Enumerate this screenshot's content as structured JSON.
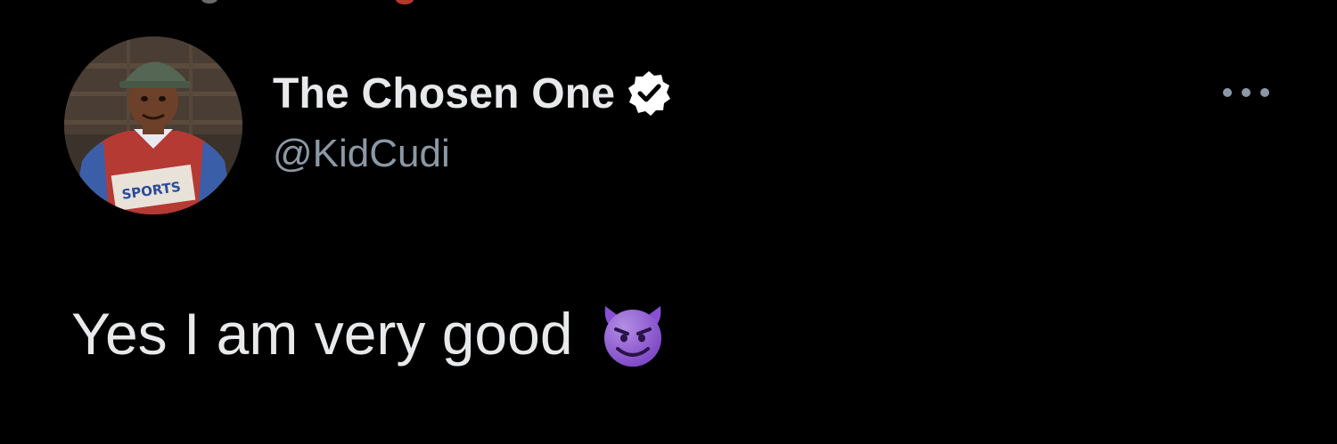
{
  "tweet": {
    "author": {
      "display_name": "The Chosen One",
      "handle": "@KidCudi",
      "verified": true,
      "avatar_icon": "child-portrait-avatar"
    },
    "more_menu_icon": "more-horizontal-icon",
    "text": "Yes I am very good",
    "emoji": "smiling-devil-emoji"
  },
  "colors": {
    "background": "#000000",
    "primary_text": "#e7e9ea",
    "secondary_text": "#8b98a5",
    "verified_badge": "#ffffff",
    "emoji_purple": "#8a4fd6"
  }
}
